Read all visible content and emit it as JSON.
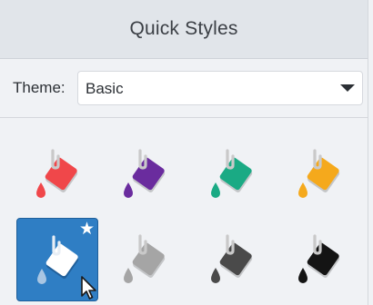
{
  "panel": {
    "title": "Quick Styles",
    "theme": {
      "label": "Theme:",
      "value": "Basic"
    }
  },
  "styles": [
    {
      "name": "style-red",
      "color": "#f0474a",
      "selected": false
    },
    {
      "name": "style-purple",
      "color": "#6a2c9e",
      "selected": false
    },
    {
      "name": "style-teal",
      "color": "#1aaa84",
      "selected": false
    },
    {
      "name": "style-orange",
      "color": "#f5a91c",
      "selected": false
    },
    {
      "name": "style-white",
      "color": "#ffffff",
      "selected": true,
      "icon": "star-icon"
    },
    {
      "name": "style-gray",
      "color": "#a5a5a5",
      "selected": false
    },
    {
      "name": "style-dark-gray",
      "color": "#4a4a4a",
      "selected": false
    },
    {
      "name": "style-black",
      "color": "#141414",
      "selected": false
    }
  ]
}
